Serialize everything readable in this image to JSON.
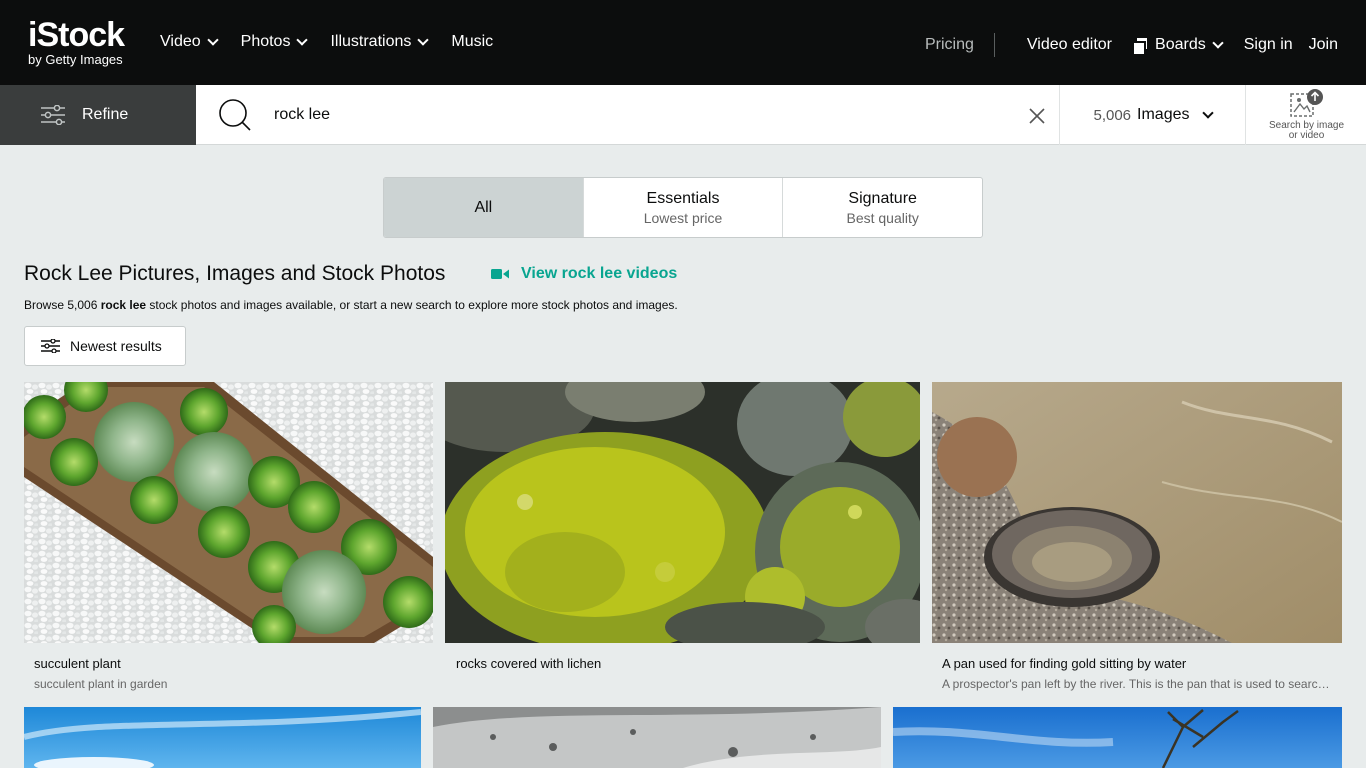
{
  "brand": {
    "name": "iStock",
    "tagline": "by Getty Images"
  },
  "nav": {
    "left": [
      {
        "label": "Video",
        "has_dropdown": true
      },
      {
        "label": "Photos",
        "has_dropdown": true
      },
      {
        "label": "Illustrations",
        "has_dropdown": true
      },
      {
        "label": "Music",
        "has_dropdown": false
      }
    ],
    "pricing": "Pricing",
    "video_editor": "Video editor",
    "boards": "Boards",
    "sign_in": "Sign in",
    "join": "Join"
  },
  "search": {
    "refine_label": "Refine",
    "query": "rock lee",
    "result_count": "5,006",
    "media_type": "Images",
    "search_by_image_line1": "Search by image",
    "search_by_image_line2": "or video"
  },
  "license_tabs": [
    {
      "title": "All",
      "subtitle": "",
      "active": true
    },
    {
      "title": "Essentials",
      "subtitle": "Lowest price",
      "active": false
    },
    {
      "title": "Signature",
      "subtitle": "Best quality",
      "active": false
    }
  ],
  "headline": {
    "title": "Rock Lee Pictures, Images and Stock Photos",
    "video_link": "View rock lee videos",
    "browse_prefix": "Browse 5,006 ",
    "browse_query": "rock lee",
    "browse_suffix": " stock photos and images available, or start a new search to explore more stock photos and images."
  },
  "sort": {
    "label": "Newest results"
  },
  "results": [
    {
      "title": "succulent plant",
      "description": "succulent plant in garden"
    },
    {
      "title": "rocks covered with lichen",
      "description": ""
    },
    {
      "title": "A pan used for finding gold sitting by water",
      "description": "A prospector's pan left by the river. This is the pan that is used to search for gold in rivers."
    },
    {
      "title": "",
      "description": ""
    },
    {
      "title": "",
      "description": ""
    },
    {
      "title": "",
      "description": ""
    }
  ],
  "colors": {
    "nav_bg": "#0c0d0d",
    "refine_bg": "#3a3d3d",
    "accent": "#08a590",
    "page_bg": "#e8ecec",
    "active_tab": "#ccd3d3"
  }
}
